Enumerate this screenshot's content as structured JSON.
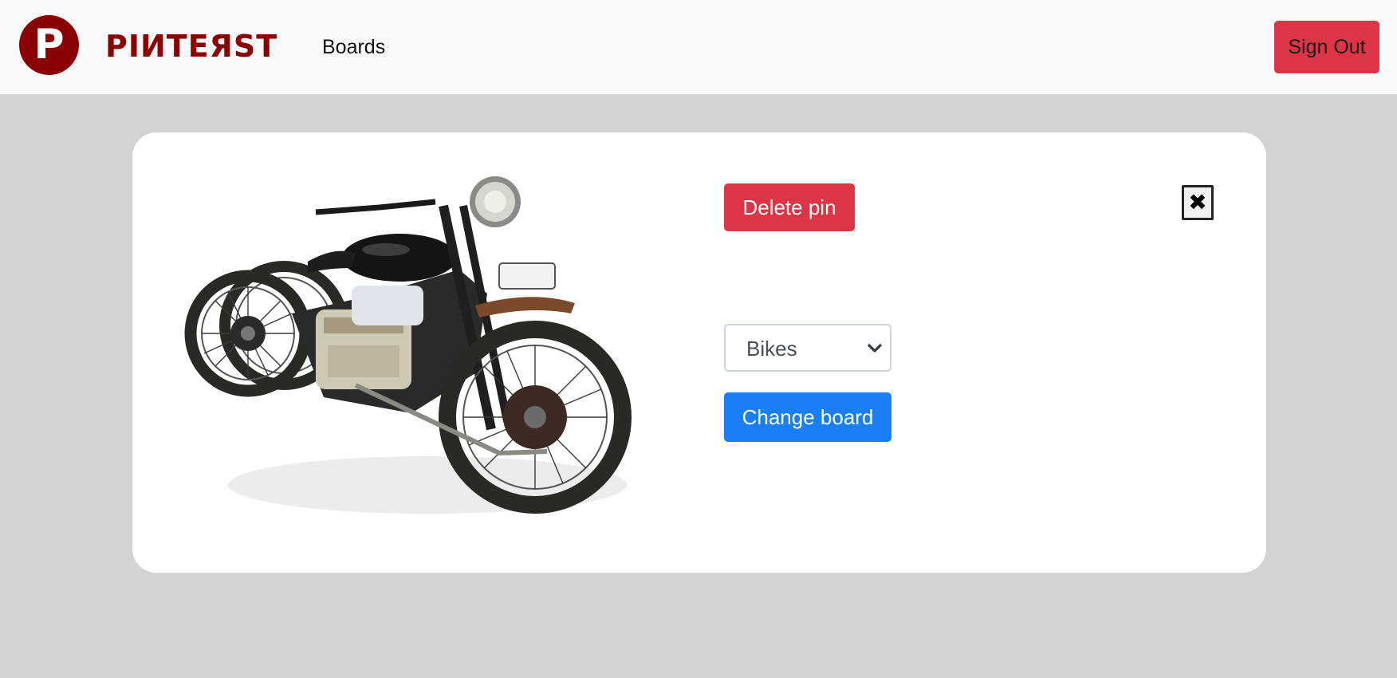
{
  "navbar": {
    "logo_letter": "P",
    "brand": "PIИTEЯST",
    "boards_link": "Boards",
    "sign_out_label": "Sign Out"
  },
  "pin_modal": {
    "image_icon": "motorcycle-photo",
    "delete_label": "Delete pin",
    "close_label": "✖",
    "board_select": {
      "selected": "Bikes",
      "icon": "chevron-down-icon"
    },
    "change_board_label": "Change board"
  },
  "colors": {
    "brand": "#8b0000",
    "danger": "#dc3545",
    "primary": "#1a7ff5",
    "page_bg": "#d3d3d3",
    "navbar_bg": "#f8f9fa"
  }
}
